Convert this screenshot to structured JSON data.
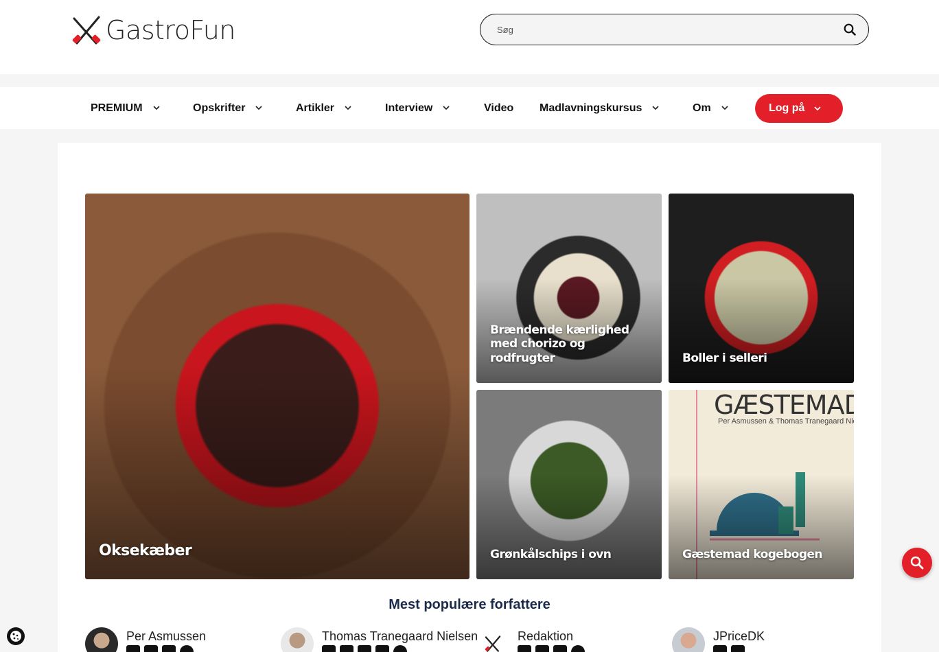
{
  "header": {
    "logo_text": "GastroFun",
    "search_placeholder": "Søg"
  },
  "nav": {
    "items": [
      {
        "label": "PREMIUM",
        "dropdown": true
      },
      {
        "label": "Opskrifter",
        "dropdown": true
      },
      {
        "label": "Artikler",
        "dropdown": true
      },
      {
        "label": "Interview",
        "dropdown": true
      },
      {
        "label": "Video",
        "dropdown": false
      },
      {
        "label": "Madlavningskursus",
        "dropdown": true
      },
      {
        "label": "Om",
        "dropdown": true
      }
    ],
    "login_label": "Log på"
  },
  "featured": [
    {
      "title": "Oksekæber"
    },
    {
      "title": "Brændende kærlighed med chorizo og rodfrugter"
    },
    {
      "title": "Boller i selleri"
    },
    {
      "title": "Grønkålschips i ovn"
    },
    {
      "title": "Gæstemad kogebogen",
      "cover_title": "GÆSTEMAD",
      "cover_subtitle": "Per Asmussen & Thomas Tranegaard Nielsen"
    }
  ],
  "authors": {
    "heading": "Mest populære forfattere",
    "list": [
      {
        "name": "Per Asmussen",
        "socials": [
          "facebook-icon",
          "instagram-icon",
          "linkedin-icon",
          "website-icon"
        ]
      },
      {
        "name": "Thomas Tranegaard Nielsen",
        "socials": [
          "facebook-icon",
          "instagram-icon",
          "linkedin-icon",
          "youtube-icon",
          "website-icon"
        ]
      },
      {
        "name": "Redaktion",
        "socials": [
          "facebook-icon",
          "instagram-icon",
          "youtube-icon",
          "website-icon"
        ]
      },
      {
        "name": "JPriceDK",
        "socials": [
          "instagram-icon",
          "youtube-icon"
        ]
      }
    ]
  },
  "colors": {
    "accent": "#e3202a",
    "heading": "#1b2a4a"
  }
}
